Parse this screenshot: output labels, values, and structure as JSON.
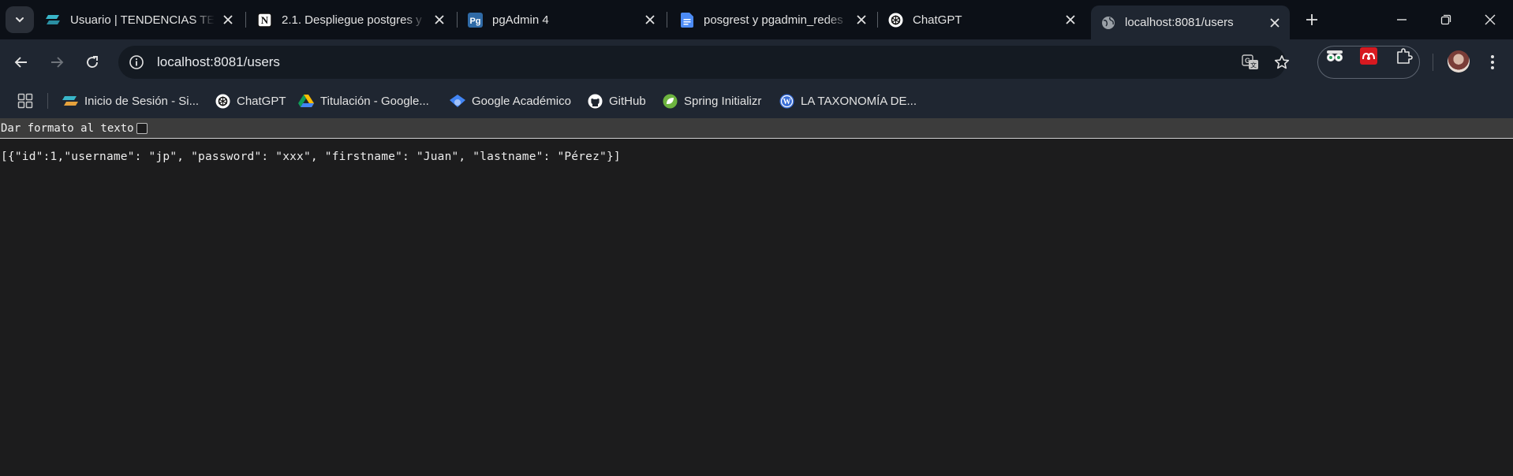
{
  "tabs": [
    {
      "title": "Usuario | TENDENCIAS TEC",
      "favicon": "tendencias-icon"
    },
    {
      "title": "2.1. Despliegue postgres y",
      "favicon": "notion-icon"
    },
    {
      "title": "pgAdmin 4",
      "favicon": "pgadmin-icon"
    },
    {
      "title": "posgrest y pgadmin_redes",
      "favicon": "google-docs-icon"
    },
    {
      "title": "ChatGPT",
      "favicon": "chatgpt-icon"
    },
    {
      "title": "localhost:8081/users",
      "favicon": "globe-icon",
      "active": true
    }
  ],
  "address_bar": {
    "url": "localhost:8081/users"
  },
  "bookmarks": [
    {
      "label": "Inicio de Sesión - Si...",
      "icon": "site-icon"
    },
    {
      "label": "ChatGPT",
      "icon": "chatgpt-icon"
    },
    {
      "label": "Titulación - Google...",
      "icon": "google-drive-icon"
    },
    {
      "label": "Google Académico",
      "icon": "google-scholar-icon"
    },
    {
      "label": "GitHub",
      "icon": "github-icon"
    },
    {
      "label": "Spring Initializr",
      "icon": "spring-icon"
    },
    {
      "label": "LA TAXONOMÍA DE...",
      "icon": "wordpress-icon"
    }
  ],
  "page": {
    "pretty_print_label": "Dar formato al texto",
    "pretty_print_checked": false,
    "json_text": "[{\"id\":1,\"username\": \"jp\", \"password\": \"xxx\", \"firstname\": \"Juan\", \"lastname\": \"Pérez\"}]"
  },
  "colors": {
    "tabstrip_bg": "#0c1017",
    "toolbar_bg": "#1f2631",
    "omnibox_bg": "#141a22",
    "page_bg": "#1c1c1d"
  }
}
